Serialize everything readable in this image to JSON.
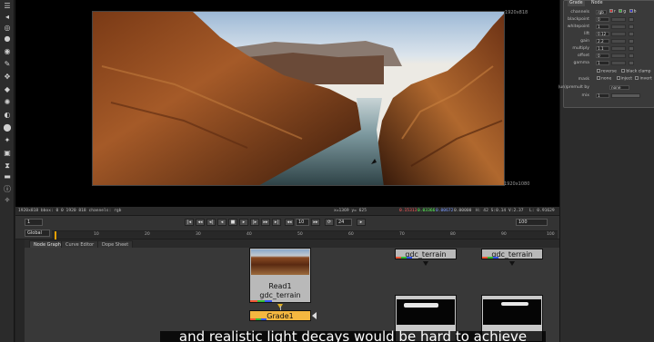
{
  "viewer": {
    "format_top": "1920x818",
    "format_bottom": "1920x1080",
    "info_left": "1920x818 bbox: 0 0 1920 818 channels: rgb",
    "info_coords": "x=1369 y= 625",
    "info_r": "0.15313",
    "info_g": "0.03366",
    "info_b": "0.00672",
    "info_a": "0.00000",
    "info_hsv": "H: 42 S:0.14 V:2.37",
    "info_l": "L: 0.91629"
  },
  "playback": {
    "frame": "1",
    "fps": "24",
    "step": "10",
    "view": "Global",
    "timeline_ticks": [
      "10",
      "20",
      "30",
      "40",
      "50",
      "60",
      "70",
      "80",
      "90",
      "100"
    ],
    "end_frame": "100"
  },
  "tabs": [
    "Node Graph",
    "Curve Editor",
    "Dope Sheet"
  ],
  "nodes": {
    "read_title": "Read1",
    "read_file": "gdc_terrain",
    "grade_label": "Grade1",
    "node2_label": "gdc_terrain",
    "node3_label": "gdc_terrain"
  },
  "properties": {
    "tabs": [
      "Grade",
      "Node"
    ],
    "channels_label": "channels",
    "channels_value": "rgb",
    "channel_flags": [
      "r",
      "g",
      "b"
    ],
    "rows": [
      {
        "label": "blackpoint",
        "value": "0"
      },
      {
        "label": "whitepoint",
        "value": "1"
      },
      {
        "label": "lift",
        "value": "0.12"
      },
      {
        "label": "gain",
        "value": "2.2"
      },
      {
        "label": "multiply",
        "value": "1.1"
      },
      {
        "label": "offset",
        "value": "0"
      },
      {
        "label": "gamma",
        "value": "1"
      }
    ],
    "reverse_label": "reverse",
    "black_clamp_label": "black clamp",
    "mask_label": "mask",
    "mask_value": "none",
    "inject_label": "inject",
    "invert_label": "invert",
    "unpremult_label": "(un)premult by",
    "unpremult_value": "none",
    "mix_label": "mix",
    "mix_value": "1"
  },
  "caption": "and realistic light decays would be hard to achieve",
  "colors": {
    "grade_node": "#f4b740",
    "read_node": "#b9b9b9",
    "playhead": "#e8a000"
  }
}
